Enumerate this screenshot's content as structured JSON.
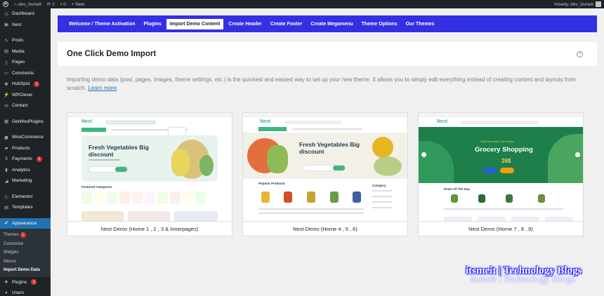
{
  "adminbar": {
    "site_name": "dev_itsmeit",
    "updates_count": "2",
    "comments_count": "0",
    "new_label": "+ New",
    "howdy": "Howdy, dev_itsmeit"
  },
  "sidebar": {
    "items": [
      {
        "label": "Dashboard",
        "icon": "dashboard-icon",
        "glyph": "◷"
      },
      {
        "label": "Nest",
        "icon": "nest-icon",
        "glyph": "▣"
      },
      {
        "label": "Posts",
        "icon": "pin-icon",
        "glyph": "✎"
      },
      {
        "label": "Media",
        "icon": "media-icon",
        "glyph": "▤"
      },
      {
        "label": "Pages",
        "icon": "pages-icon",
        "glyph": "▯"
      },
      {
        "label": "Comments",
        "icon": "comments-icon",
        "glyph": "▭"
      },
      {
        "label": "HubSpot",
        "icon": "hubspot-icon",
        "glyph": "✺",
        "badge": "1"
      },
      {
        "label": "WPClever",
        "icon": "wpclever-icon",
        "glyph": "⚡"
      },
      {
        "label": "Contact",
        "icon": "contact-icon",
        "glyph": "✉"
      },
      {
        "label": "GetWooPlugins",
        "icon": "plugin-icon",
        "glyph": "▦"
      },
      {
        "label": "WooCommerce",
        "icon": "woocommerce-icon",
        "glyph": "◼"
      },
      {
        "label": "Products",
        "icon": "products-icon",
        "glyph": "▰"
      },
      {
        "label": "Payments",
        "icon": "payments-icon",
        "glyph": "$",
        "badge": "1"
      },
      {
        "label": "Analytics",
        "icon": "analytics-icon",
        "glyph": "▮"
      },
      {
        "label": "Marketing",
        "icon": "marketing-icon",
        "glyph": "◢"
      },
      {
        "label": "Elementor",
        "icon": "elementor-icon",
        "glyph": "ⓔ"
      },
      {
        "label": "Templates",
        "icon": "templates-icon",
        "glyph": "▤"
      },
      {
        "label": "Appearance",
        "icon": "appearance-icon",
        "glyph": "✐"
      },
      {
        "label": "Plugins",
        "icon": "plugins-icon",
        "glyph": "✚",
        "badge": "1"
      },
      {
        "label": "Users",
        "icon": "users-icon",
        "glyph": "●"
      }
    ],
    "submenu": [
      {
        "label": "Themes",
        "badge": "1"
      },
      {
        "label": "Customize"
      },
      {
        "label": "Widgets"
      },
      {
        "label": "Menus"
      },
      {
        "label": "Import Demo Data"
      }
    ]
  },
  "topnav": {
    "tabs": [
      "Welcome / Theme Activation",
      "Plugins",
      "Import Demo Content",
      "Create Header",
      "Create Footer",
      "Create Megamenu",
      "Theme Options",
      "Our Themes"
    ],
    "active_index": 2
  },
  "panel": {
    "title": "One Click Demo Import",
    "help_icon": "?"
  },
  "intro": {
    "text": "Importing demo data (post, pages, images, theme settings, etc.) is the quickest and easiest way to set up your new theme. It allows you to simply edit everything instead of creating content and layouts from scratch.",
    "link": "Learn more",
    "after_link": "."
  },
  "demos": [
    {
      "caption": "Nest Demo (Home 1 , 2 , 3 & Innerpages)",
      "logo": "Nest",
      "headline": "Fresh Vegetables Big discount"
    },
    {
      "caption": "Nest Demo (Home 4 , 5 , 6)",
      "logo": "Nest",
      "headline": "Fresh Vegetables Big discount"
    },
    {
      "caption": "Nest Demo (Home 7 , 8 , 9)",
      "logo": "Nest",
      "headline": "Grocery Shopping",
      "price": "26$",
      "promo": "Only this week. Don't miss..."
    }
  ],
  "thumbs": {
    "featured": "Featured Categories",
    "popular": "Popular Products",
    "category": "Category",
    "deals": "Deals Of The Day"
  },
  "watermark": "itsmeit | Technology Blogs",
  "colors": {
    "admin_dark": "#1d2327",
    "accent_blue": "#2271b1",
    "nav_blue": "#3330e4",
    "nest_green": "#3bb77e",
    "badge_red": "#d63638"
  }
}
